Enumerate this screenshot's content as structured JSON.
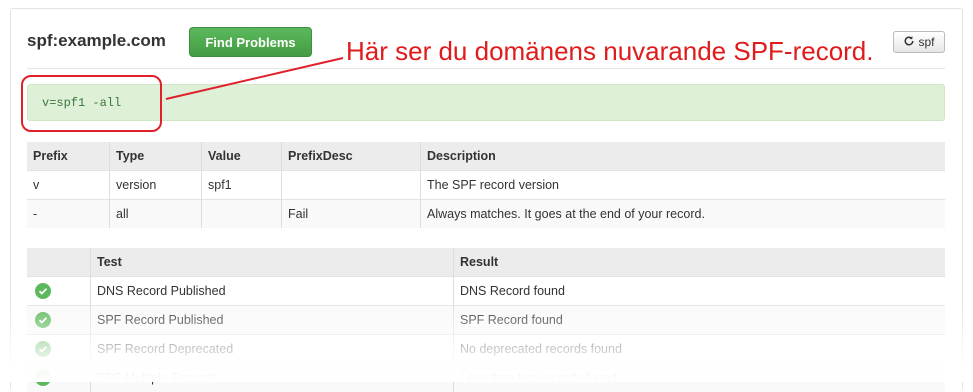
{
  "header": {
    "title": "spf:example.com",
    "find_label": "Find Problems",
    "spf_label": "spf"
  },
  "record": {
    "text": "v=spf1 -all"
  },
  "annotation": {
    "text": "Här ser du domänens nuvarande SPF-record.",
    "color": "#e01b1b"
  },
  "record_table": {
    "headers": [
      "Prefix",
      "Type",
      "Value",
      "PrefixDesc",
      "Description"
    ],
    "rows": [
      [
        "v",
        "version",
        "spf1",
        "",
        "The SPF record version"
      ],
      [
        "-",
        "all",
        "",
        "Fail",
        "Always matches. It goes at the end of your record."
      ]
    ]
  },
  "test_table": {
    "headers": [
      "",
      "Test",
      "Result"
    ],
    "rows": [
      {
        "status_icon": "check-circle-icon",
        "test": "DNS Record Published",
        "result": "DNS Record found"
      },
      {
        "status_icon": "check-circle-icon",
        "test": "SPF Record Published",
        "result": "SPF Record found"
      },
      {
        "status_icon": "check-circle-icon",
        "test": "SPF Record Deprecated",
        "result": "No deprecated records found"
      },
      {
        "status_icon": "check-circle-icon",
        "test": "SPF Multiple Records",
        "result": "Less than two records found"
      }
    ]
  },
  "colors": {
    "success": "#5cb85c",
    "record_bg": "#dff0d8",
    "annotation": "#e01b1b"
  }
}
